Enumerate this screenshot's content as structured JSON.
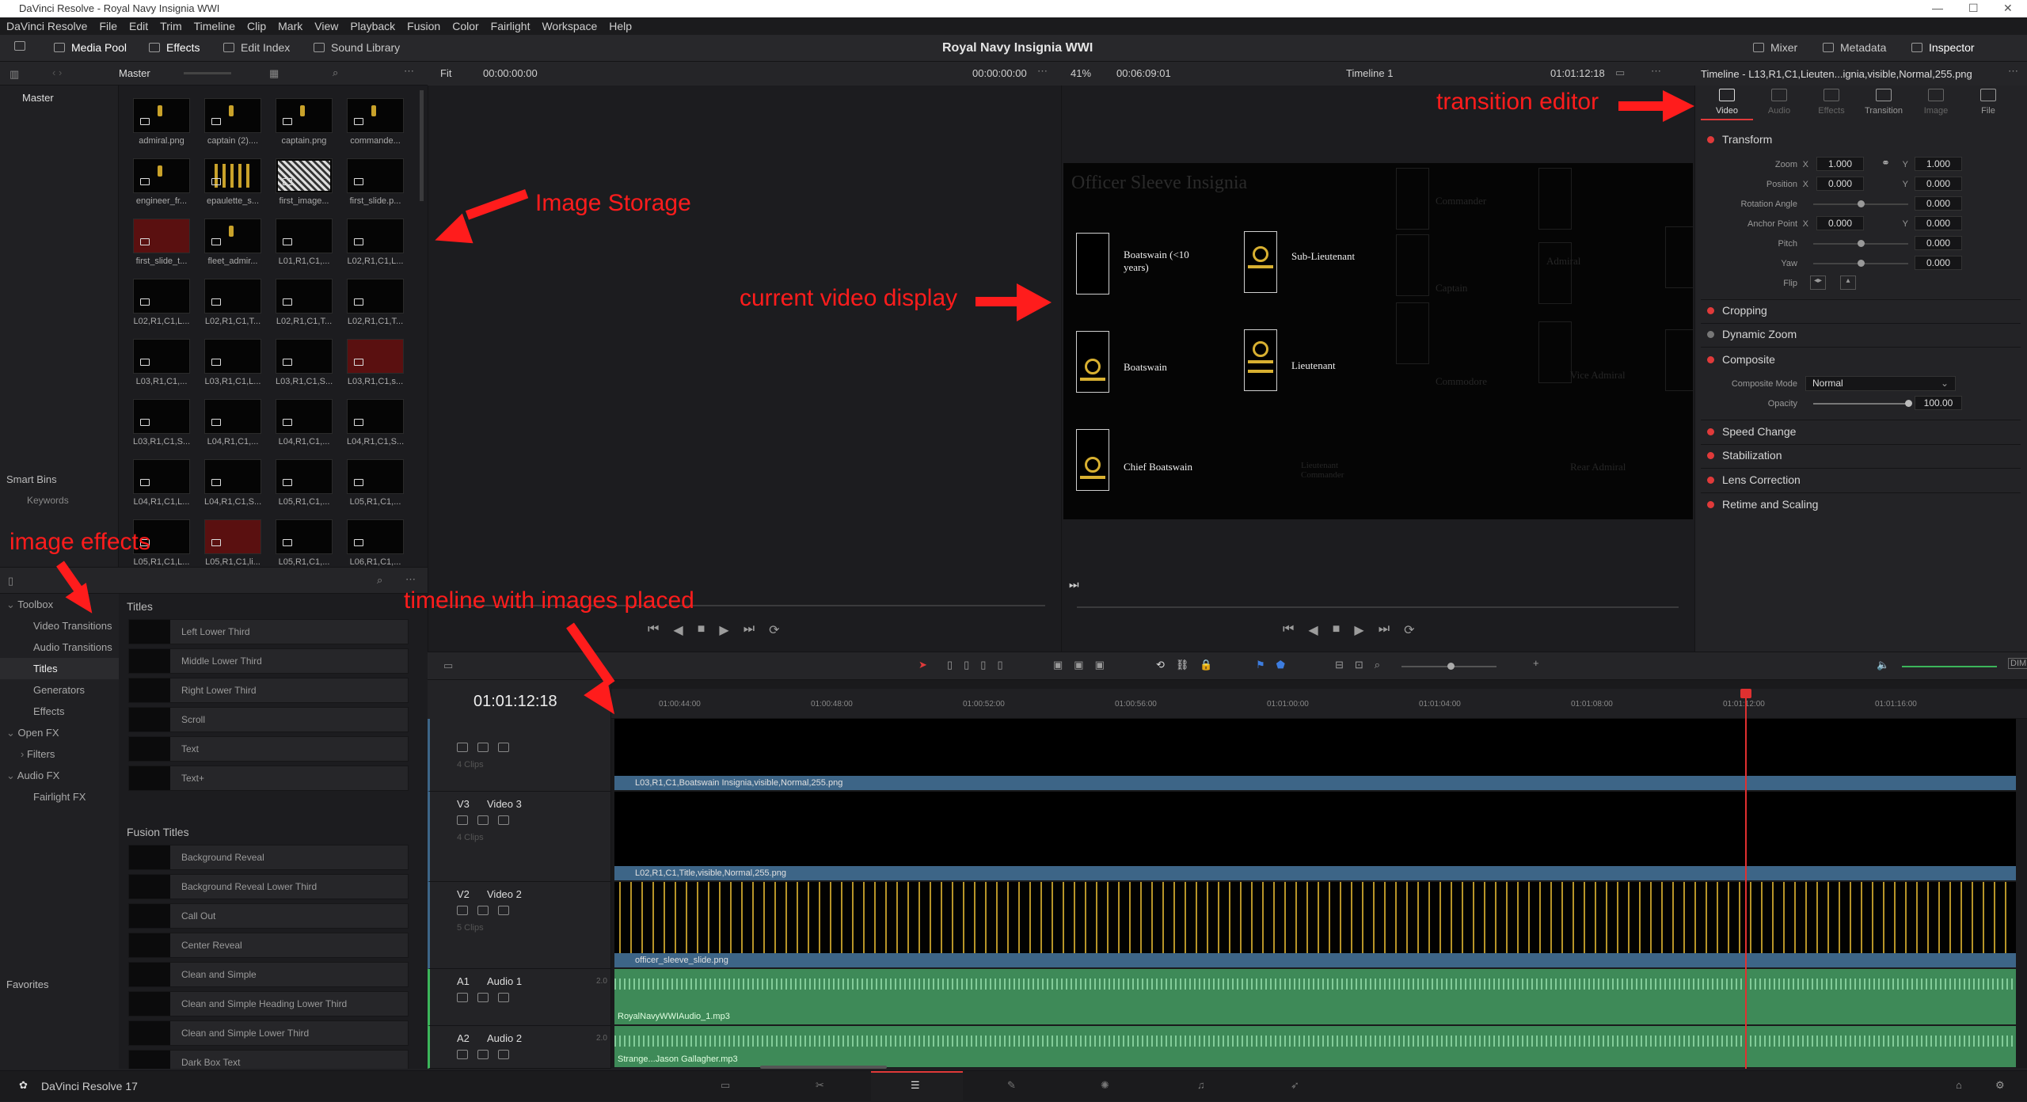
{
  "window": {
    "title": "DaVinci Resolve - Royal Navy Insignia WWI"
  },
  "menu": [
    "DaVinci Resolve",
    "File",
    "Edit",
    "Trim",
    "Timeline",
    "Clip",
    "Mark",
    "View",
    "Playback",
    "Fusion",
    "Color",
    "Fairlight",
    "Workspace",
    "Help"
  ],
  "toolbar": {
    "media_pool": "Media Pool",
    "effects": "Effects",
    "edit_index": "Edit Index",
    "sound_library": "Sound Library",
    "project_title": "Royal Navy Insignia WWI",
    "mixer": "Mixer",
    "metadata": "Metadata",
    "inspector": "Inspector"
  },
  "media_pool": {
    "bin_name": "Master",
    "root": "Master",
    "smart_bins": "Smart Bins",
    "keywords": "Keywords",
    "clips": [
      "admiral.png",
      "captain (2)....",
      "captain.png",
      "commande...",
      "engineer_fr...",
      "epaulette_s...",
      "first_image...",
      "first_slide.p...",
      "first_slide_t...",
      "fleet_admir...",
      "L01,R1,C1,...",
      "L02,R1,C1,L...",
      "L02,R1,C1,L...",
      "L02,R1,C1,T...",
      "L02,R1,C1,T...",
      "L02,R1,C1,T...",
      "L03,R1,C1,...",
      "L03,R1,C1,L...",
      "L03,R1,C1,S...",
      "L03,R1,C1,s...",
      "L03,R1,C1,S...",
      "L04,R1,C1,...",
      "L04,R1,C1,...",
      "L04,R1,C1,S...",
      "L04,R1,C1,L...",
      "L04,R1,C1,S...",
      "L05,R1,C1,...",
      "L05,R1,C1,...",
      "L05,R1,C1,L...",
      "L05,R1,C1,li...",
      "L05,R1,C1,...",
      "L06,R1,C1,..."
    ]
  },
  "effects": {
    "tree": [
      "Toolbox",
      "Video Transitions",
      "Audio Transitions",
      "Titles",
      "Generators",
      "Effects",
      "Open FX",
      "Filters",
      "Audio FX",
      "Fairlight FX"
    ],
    "favorites": "Favorites",
    "titles_header": "Titles",
    "titles": [
      "Left Lower Third",
      "Middle Lower Third",
      "Right Lower Third",
      "Scroll",
      "Text",
      "Text+"
    ],
    "fusion_header": "Fusion Titles",
    "fusion_titles": [
      "Background Reveal",
      "Background Reveal Lower Third",
      "Call Out",
      "Center Reveal",
      "Clean and Simple",
      "Clean and Simple Heading Lower Third",
      "Clean and Simple Lower Third",
      "Dark Box Text"
    ]
  },
  "source_viewer": {
    "fit": "Fit",
    "tc_left": "00:00:00:00",
    "tc_right": "00:00:00:00"
  },
  "program_viewer": {
    "zoom": "41%",
    "duration": "00:06:09:01",
    "timeline": "Timeline 1",
    "timecode": "01:01:12:18",
    "slide_title": "Officer Sleeve Insignia",
    "labels": [
      "Boatswain (<10 years)",
      "Sub-Lieutenant",
      "Boatswain",
      "Lieutenant",
      "Chief Boatswain"
    ],
    "ghost_labels": [
      "Commander",
      "Captain",
      "Commodore",
      "Lieutenant Commander",
      "Rear Admiral",
      "Vice Admiral",
      "Admiral"
    ]
  },
  "inspector": {
    "header": "Timeline - L13,R1,C1,Lieuten...ignia,visible,Normal,255.png",
    "tabs": [
      "Video",
      "Audio",
      "Effects",
      "Transition",
      "Image",
      "File"
    ],
    "transform": "Transform",
    "zoom_label": "Zoom",
    "zoom_x": "1.000",
    "zoom_y": "1.000",
    "position_label": "Position",
    "pos_x": "0.000",
    "pos_y": "0.000",
    "rotation_label": "Rotation Angle",
    "rotation": "0.000",
    "anchor_label": "Anchor Point",
    "anchor_x": "0.000",
    "anchor_y": "0.000",
    "pitch_label": "Pitch",
    "pitch": "0.000",
    "yaw_label": "Yaw",
    "yaw": "0.000",
    "flip_label": "Flip",
    "cropping": "Cropping",
    "dynamic_zoom": "Dynamic Zoom",
    "composite": "Composite",
    "composite_mode_label": "Composite Mode",
    "composite_mode": "Normal",
    "opacity_label": "Opacity",
    "opacity": "100.00",
    "speed_change": "Speed Change",
    "stabilization": "Stabilization",
    "lens_correction": "Lens Correction",
    "retime": "Retime and Scaling"
  },
  "timeline": {
    "timecode": "01:01:12:18",
    "ruler": [
      "01:00:44:00",
      "01:00:48:00",
      "01:00:52:00",
      "01:00:56:00",
      "01:01:00:00",
      "01:01:04:00",
      "01:01:08:00",
      "01:01:12:00",
      "01:01:16:00"
    ],
    "tracks": [
      {
        "id": "",
        "name": "",
        "count": "4 Clips",
        "clip": "L03,R1,C1,Boatswain Insignia,visible,Normal,255.png"
      },
      {
        "id": "V3",
        "name": "Video 3",
        "count": "4 Clips",
        "clip": "L02,R1,C1,Title,visible,Normal,255.png"
      },
      {
        "id": "V2",
        "name": "Video 2",
        "count": "5 Clips",
        "clip": "officer_sleeve_slide.png"
      },
      {
        "id": "A1",
        "name": "Audio 1",
        "gain": "2.0",
        "clip": "RoyalNavyWWIAudio_1.mp3"
      },
      {
        "id": "A2",
        "name": "Audio 2",
        "gain": "2.0",
        "clip": "Strange...Jason Gallagher.mp3"
      }
    ]
  },
  "app": {
    "name": "DaVinci Resolve 17"
  },
  "annotations": {
    "transition_editor": "transition editor",
    "image_storage": "Image Storage",
    "current_video": "current video display",
    "image_effects": "image effects",
    "timeline_images": "timeline with images placed"
  },
  "colors": {
    "accent": "#e03a3a",
    "annotation": "#ff1c1c",
    "audio": "#3e8a58",
    "video_clip": "#3d6587"
  }
}
